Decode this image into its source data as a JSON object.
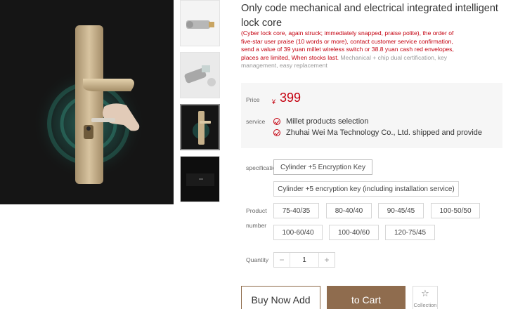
{
  "product": {
    "title": "Only code mechanical and electrical integrated intelligent lock core",
    "subtitle_red": "(Cyber lock core, again struck; immediately snapped, praise polite), the order of five-star user praise (10 words or more), contact customer service confirmation, send a value of 39 yuan millet wireless switch or 38.8 yuan cash red envelopes, places are limited, When stocks last.",
    "subtitle_grey": " Mechanical + chip dual certification, key management, easy replacement"
  },
  "price": {
    "label": "Price",
    "currency": "¥",
    "value": "399"
  },
  "service": {
    "label": "service",
    "items": [
      "Millet products selection",
      "Zhuhai Wei Ma Technology Co., Ltd. shipped and provide"
    ]
  },
  "specification": {
    "label": "specification",
    "options": [
      "Cylinder +5 Encryption Key",
      "Cylinder +5 encryption key (including installation service)"
    ]
  },
  "product_number": {
    "label_line1": "Product",
    "label_line2": "number",
    "options": [
      "75-40/35",
      "80-40/40",
      "90-45/45",
      "100-50/50",
      "100-60/40",
      "100-40/60",
      "120-75/45"
    ]
  },
  "quantity": {
    "label": "Quantity",
    "minus": "−",
    "value": "1",
    "plus": "+"
  },
  "actions": {
    "buy_now": "Buy Now Add",
    "to_cart": "to Cart",
    "collection": "Collection",
    "collection_icon": "☆"
  },
  "colors": {
    "accent_red": "#c4000f",
    "brand_brown": "#8f6c4e"
  }
}
